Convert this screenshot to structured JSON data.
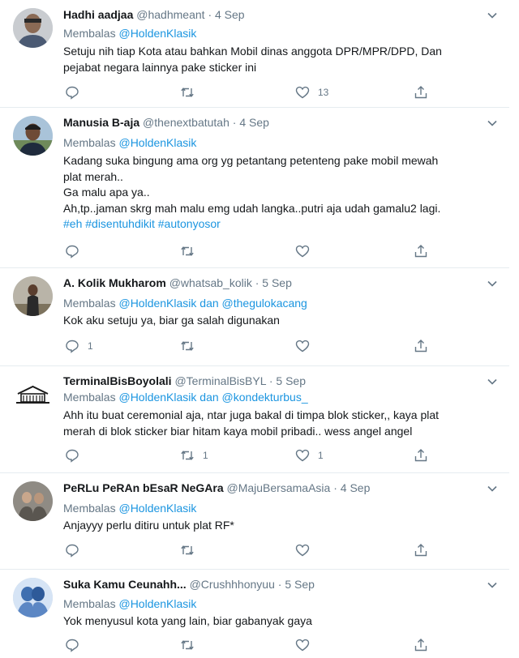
{
  "reply_prefix": "Membalas",
  "conjunction": "dan",
  "tweets": [
    {
      "name": "Hadhi aadjaa",
      "handle": "@hadhmeant",
      "date": "4 Sep",
      "mentions": [
        "@HoldenKlasik"
      ],
      "lines": [
        "Setuju nih tiap Kota atau bahkan Mobil dinas anggota DPR/MPR/DPD, Dan",
        "pejabat negara lainnya pake sticker ini"
      ],
      "hashtags": [],
      "reply_count": "",
      "retweet_count": "",
      "like_count": "13"
    },
    {
      "name": "Manusia B-aja",
      "handle": "@thenextbatutah",
      "date": "4 Sep",
      "mentions": [
        "@HoldenKlasik"
      ],
      "lines": [
        "Kadang suka bingung ama org yg petantang petenteng pake mobil mewah",
        "plat merah..",
        "Ga malu apa ya..",
        "Ah,tp..jaman skrg mah malu emg udah langka..putri aja udah gamalu2 lagi."
      ],
      "hashtags": [
        "#eh",
        "#disentuhdikit",
        "#autonyosor"
      ],
      "reply_count": "",
      "retweet_count": "",
      "like_count": ""
    },
    {
      "name": "A. Kolik Mukharom",
      "handle": "@whatsab_kolik",
      "date": "5 Sep",
      "mentions": [
        "@HoldenKlasik",
        "@thegulokacang"
      ],
      "lines": [
        "Kok aku setuju ya, biar ga salah digunakan"
      ],
      "hashtags": [],
      "reply_count": "1",
      "retweet_count": "",
      "like_count": ""
    },
    {
      "name": "TerminalBisBoyolali",
      "handle": "@TerminalBisBYL",
      "date": "5 Sep",
      "mentions": [
        "@HoldenKlasik",
        "@kondekturbus_"
      ],
      "lines": [
        "Ahh itu buat ceremonial aja, ntar juga bakal di timpa blok sticker,, kaya plat",
        "merah di blok sticker biar hitam kaya mobil pribadi.. wess angel angel"
      ],
      "hashtags": [],
      "reply_count": "",
      "retweet_count": "1",
      "like_count": "1"
    },
    {
      "name": "PeRLu PeRAn bEsaR NeGArа",
      "handle": "@MajuBersamaAsia",
      "date": "4 Sep",
      "mentions": [
        "@HoldenKlasik"
      ],
      "lines": [
        "Anjayyy perlu ditiru untuk plat RF*"
      ],
      "hashtags": [],
      "reply_count": "",
      "retweet_count": "",
      "like_count": ""
    },
    {
      "name": "Suka Kamu Ceunahh...",
      "handle": "@Crushhhonyuu",
      "date": "5 Sep",
      "mentions": [
        "@HoldenKlasik"
      ],
      "lines": [
        "Yok menyusul kota yang lain, biar gabanyak gaya"
      ],
      "hashtags": [],
      "reply_count": "",
      "retweet_count": "",
      "like_count": ""
    }
  ],
  "icons": {
    "reply": "reply-icon",
    "retweet": "retweet-icon",
    "like": "heart-icon",
    "share": "share-icon",
    "more": "chevron-down-icon"
  },
  "colors": {
    "link": "#1b95e0",
    "secondary_text": "#657786",
    "divider": "#e6ecf0"
  }
}
